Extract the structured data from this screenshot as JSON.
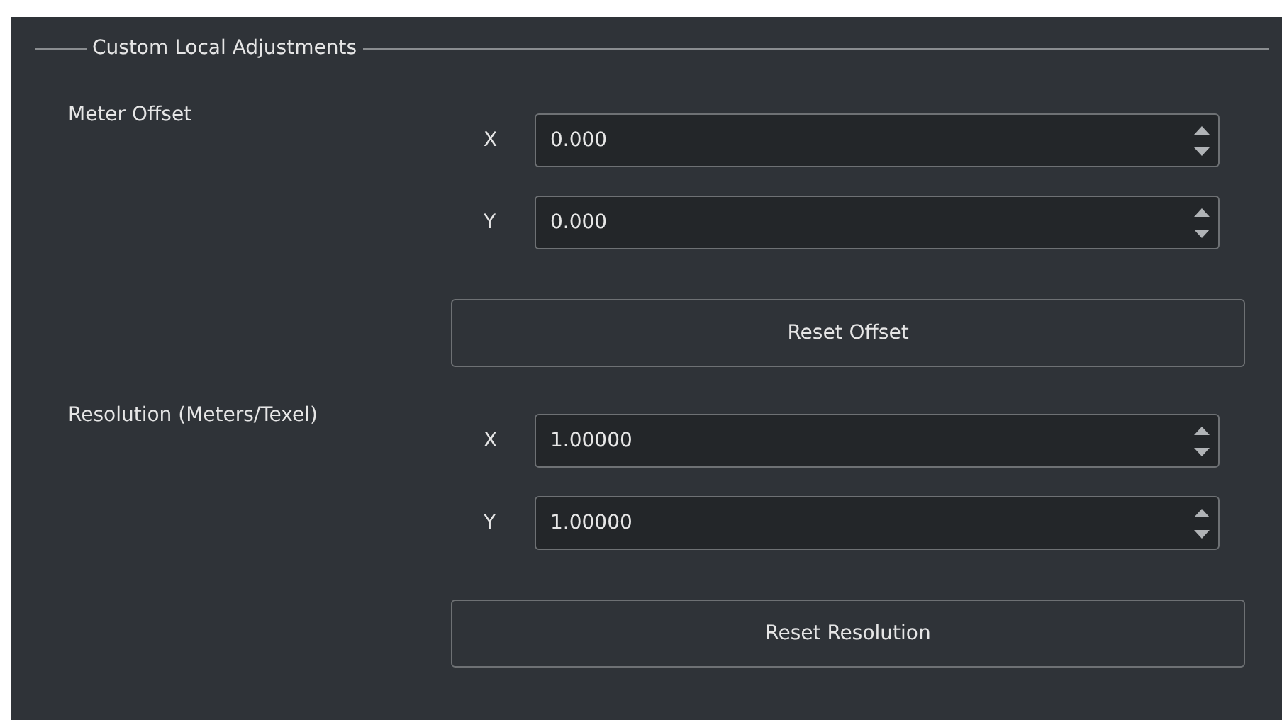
{
  "group": {
    "title": "Custom Local Adjustments"
  },
  "sections": [
    {
      "label": "Meter Offset",
      "fields": [
        {
          "axis": "X",
          "value": "0.000"
        },
        {
          "axis": "Y",
          "value": "0.000"
        }
      ],
      "reset_button": "Reset Offset"
    },
    {
      "label": "Resolution (Meters/Texel)",
      "fields": [
        {
          "axis": "X",
          "value": "1.00000"
        },
        {
          "axis": "Y",
          "value": "1.00000"
        }
      ],
      "reset_button": "Reset Resolution"
    }
  ]
}
